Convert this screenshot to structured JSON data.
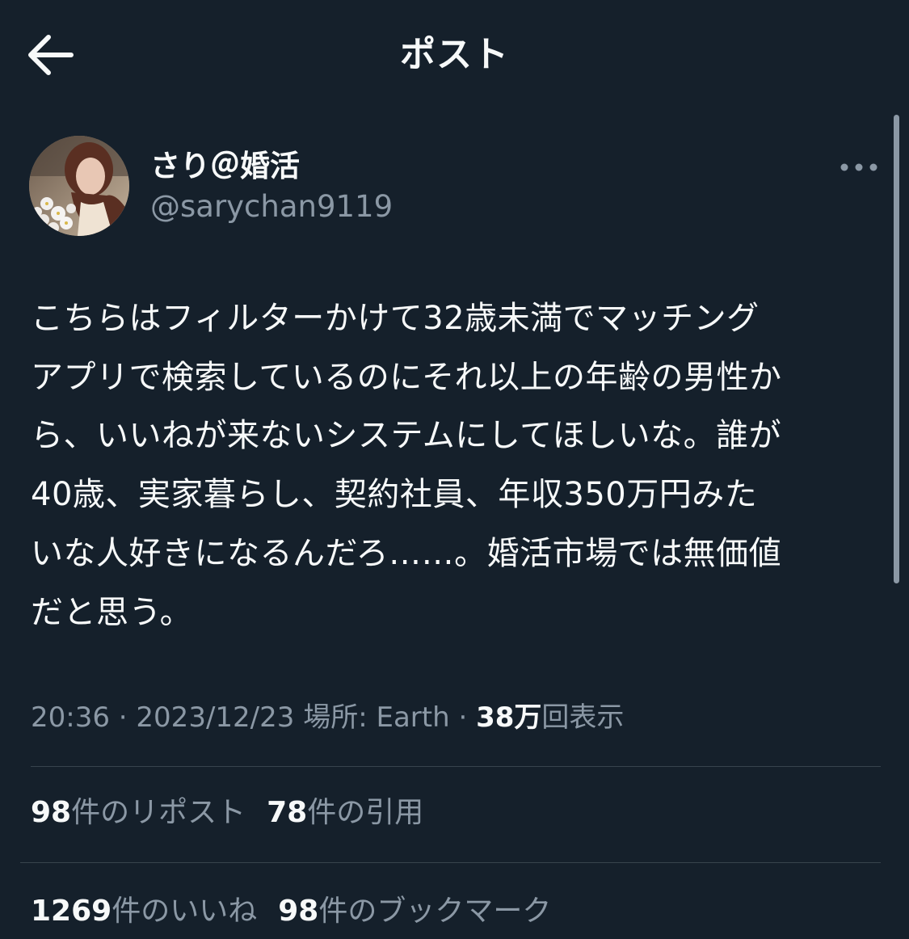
{
  "header": {
    "title": "ポスト",
    "back_icon": "arrow-left-icon"
  },
  "author": {
    "display_name": "さり＠婚活",
    "handle": "@sarychan9119"
  },
  "post": {
    "text": "こちらはフィルターかけて32歳未満でマッチング\nアプリで検索しているのにそれ以上の年齢の男性か\nら、いいねが来ないシステムにしてほしいな。誰が\n40歳、実家暮らし、契約社員、年収350万円みた\nいな人好きになるんだろ……。婚活市場では無価値\nだと思う。"
  },
  "meta": {
    "time": "20:36",
    "sep1": " · ",
    "date": "2023/12/23",
    "location_label": " 場所: ",
    "location": "Earth",
    "sep2": " · ",
    "views": "38万",
    "views_label": "回表示"
  },
  "stats_row1": {
    "reposts_count": "98",
    "reposts_label": "件のリポスト",
    "quotes_count": "78",
    "quotes_label": "件の引用"
  },
  "stats_row2": {
    "likes_count": "1269",
    "likes_label": "件のいいね",
    "bookmarks_count": "98",
    "bookmarks_label": "件のブックマーク"
  },
  "colors": {
    "background": "#15202b",
    "text_primary": "#f7f9f9",
    "text_secondary": "#8b98a5",
    "divider": "#38444d"
  }
}
